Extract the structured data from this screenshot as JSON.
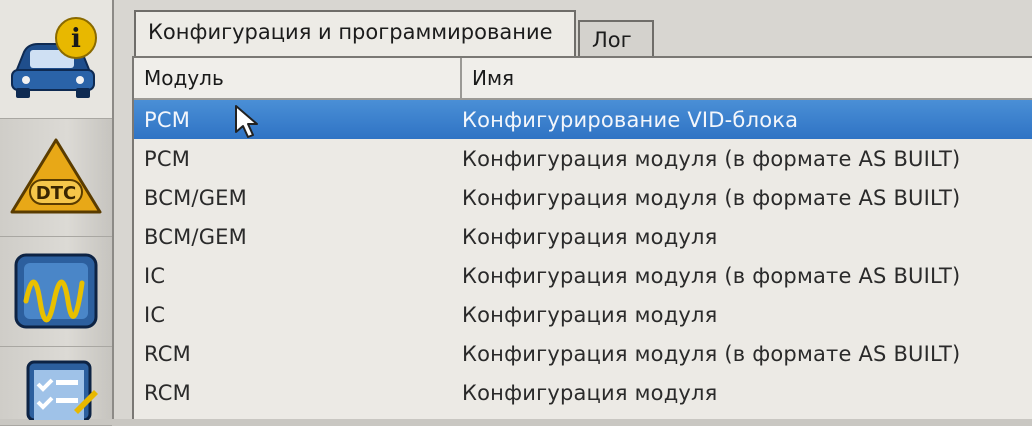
{
  "tabs": [
    {
      "label": "Конфигурация и программирование",
      "active": true
    },
    {
      "label": "Лог",
      "active": false
    }
  ],
  "table": {
    "columns": [
      "Модуль",
      "Имя"
    ],
    "rows": [
      {
        "module": "PCM",
        "name": "Конфигурирование VID-блока",
        "selected": true
      },
      {
        "module": "PCM",
        "name": "Конфигурация модуля (в формате AS BUILT)"
      },
      {
        "module": "BCM/GEM",
        "name": "Конфигурация модуля (в формате AS BUILT)"
      },
      {
        "module": "BCM/GEM",
        "name": "Конфигурация модуля"
      },
      {
        "module": "IC",
        "name": "Конфигурация модуля (в формате AS BUILT)"
      },
      {
        "module": "IC",
        "name": "Конфигурация модуля"
      },
      {
        "module": "RCM",
        "name": "Конфигурация модуля (в формате AS BUILT)"
      },
      {
        "module": "RCM",
        "name": "Конфигурация модуля"
      }
    ]
  },
  "sidebar": {
    "tools": [
      {
        "icon": "vehicle-info-icon"
      },
      {
        "icon": "dtc-icon",
        "text": "DTC"
      },
      {
        "icon": "oscilloscope-icon"
      },
      {
        "icon": "checklist-icon"
      }
    ]
  },
  "colors": {
    "selection": "#2f73c4",
    "info_badge": "#e8b800",
    "dtc_badge": "#e8a817"
  }
}
